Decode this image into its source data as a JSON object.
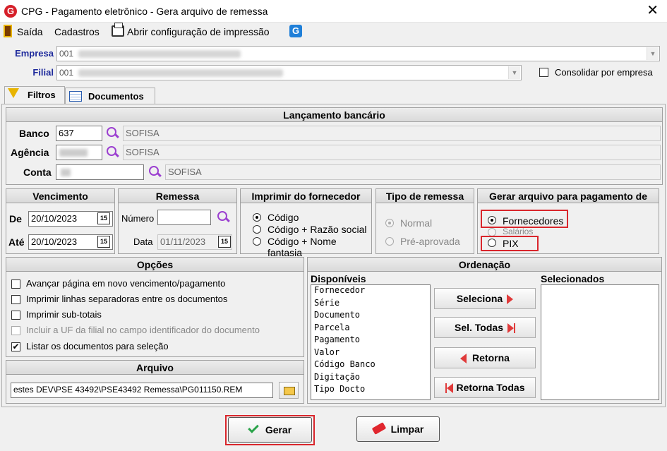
{
  "window": {
    "title": "CPG -  Pagamento eletrônico - Gera arquivo de remessa",
    "logo": "G",
    "close": "✕"
  },
  "menu": {
    "exit": "Saída",
    "cadastros": "Cadastros",
    "print_config": "Abrir configuração de impressão",
    "g_icon": "G"
  },
  "empresa": {
    "label": "Empresa",
    "value": "001"
  },
  "filial": {
    "label": "Filial",
    "value": "001",
    "consolidar_label": "Consolidar por empresa"
  },
  "tabs": [
    {
      "label": "Filtros"
    },
    {
      "label": "Documentos"
    }
  ],
  "lancamento": {
    "title": "Lançamento bancário",
    "banco": {
      "label": "Banco",
      "value": "637",
      "desc": "SOFISA"
    },
    "agencia": {
      "label": "Agência",
      "value": "",
      "desc": "SOFISA"
    },
    "conta": {
      "label": "Conta",
      "value": "",
      "desc": "SOFISA"
    }
  },
  "vencimento": {
    "title": "Vencimento",
    "de_label": "De",
    "de": "20/10/2023",
    "ate_label": "Até",
    "ate": "20/10/2023",
    "cal": "15"
  },
  "remessa": {
    "title": "Remessa",
    "numero_label": "Número",
    "numero": "",
    "data_label": "Data",
    "data": "01/11/2023"
  },
  "imprimir": {
    "title": "Imprimir do fornecedor",
    "options": [
      "Código",
      "Código + Razão social",
      "Código + Nome fantasia"
    ],
    "selected": 0
  },
  "tipo_remessa": {
    "title": "Tipo de remessa",
    "options": [
      "Normal",
      "Pré-aprovada"
    ],
    "selected": 0
  },
  "gerar_arquivo": {
    "title": "Gerar arquivo para pagamento de",
    "options": [
      "Fornecedores",
      "Salários",
      "PIX"
    ],
    "selected": 0
  },
  "opcoes": {
    "title": "Opções",
    "items": [
      {
        "label": "Avançar página em novo vencimento/pagamento",
        "checked": false,
        "enabled": true
      },
      {
        "label": "Imprimir linhas separadoras entre os documentos",
        "checked": false,
        "enabled": true
      },
      {
        "label": "Imprimir sub-totais",
        "checked": false,
        "enabled": true
      },
      {
        "label": "Incluir a UF da filial no campo identificador do documento",
        "checked": false,
        "enabled": false
      },
      {
        "label": "Listar os documentos para seleção",
        "checked": true,
        "enabled": true
      }
    ]
  },
  "arquivo": {
    "title": "Arquivo",
    "path": "estes DEV\\PSE 43492\\PSE43492 Remessa\\PG011150.REM"
  },
  "ordenacao": {
    "title": "Ordenação",
    "disponiveis_label": "Disponíveis",
    "selecionados_label": "Selecionados",
    "disponiveis": [
      "Fornecedor",
      "Série",
      "Documento",
      "Parcela",
      "Pagamento",
      "Valor",
      "Código Banco",
      "Digitação",
      "Tipo Docto"
    ],
    "buttons": {
      "seleciona": "Seleciona",
      "sel_todas": "Sel. Todas",
      "retorna": "Retorna",
      "retorna_todas": "Retorna Todas"
    }
  },
  "footer": {
    "gerar": "Gerar",
    "limpar": "Limpar"
  },
  "colors": {
    "label_blue": "#1e2a9c",
    "highlight_red": "#d9262c",
    "icon_purple": "#9b3fd0"
  }
}
